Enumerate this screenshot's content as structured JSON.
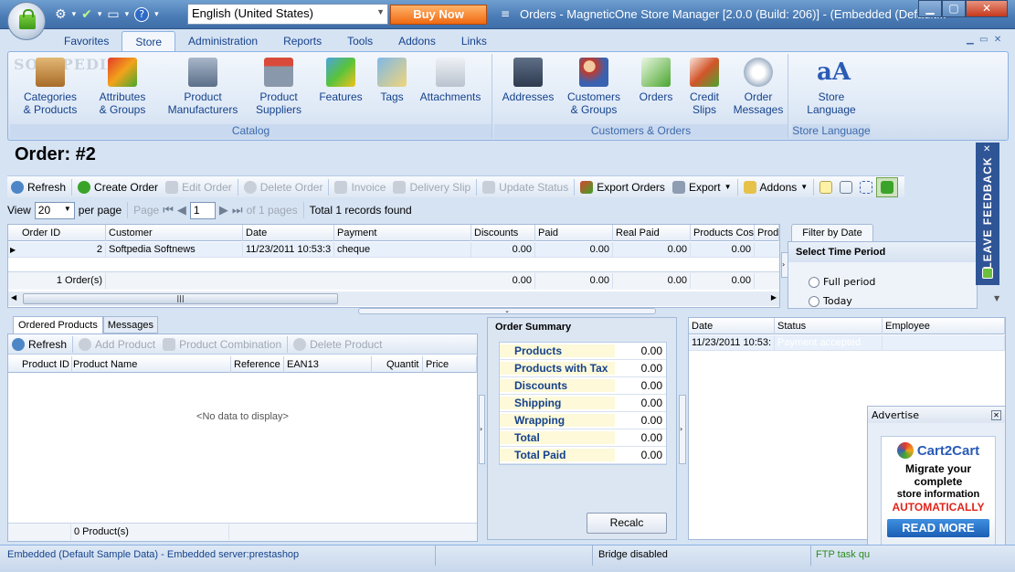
{
  "window": {
    "title": "Orders - MagneticOne Store Manager [2.0.0 (Build: 206)] - (Embedded (Default...",
    "language": "English (United States)",
    "buy_now": "Buy Now"
  },
  "ribbon": {
    "tabs": [
      "Favorites",
      "Store",
      "Administration",
      "Reports",
      "Tools",
      "Addons",
      "Links"
    ],
    "active_tab": "Store",
    "catalog": {
      "label": "Catalog",
      "buttons": [
        {
          "line1": "Categories",
          "line2": "& Products"
        },
        {
          "line1": "Attributes",
          "line2": "& Groups"
        },
        {
          "line1": "Product",
          "line2": "Manufacturers"
        },
        {
          "line1": "Product",
          "line2": "Suppliers"
        },
        {
          "line1": "Features",
          "line2": ""
        },
        {
          "line1": "Tags",
          "line2": ""
        },
        {
          "line1": "Attachments",
          "line2": ""
        }
      ]
    },
    "customers_orders": {
      "label": "Customers & Orders",
      "buttons": [
        {
          "line1": "Addresses",
          "line2": ""
        },
        {
          "line1": "Customers",
          "line2": "& Groups"
        },
        {
          "line1": "Orders",
          "line2": ""
        },
        {
          "line1": "Credit",
          "line2": "Slips"
        },
        {
          "line1": "Order",
          "line2": "Messages"
        }
      ]
    },
    "store_language": {
      "label": "Store Language",
      "buttons": [
        {
          "line1": "Store",
          "line2": "Language"
        }
      ]
    }
  },
  "order": {
    "title": "Order: #2"
  },
  "toolbar": {
    "refresh": "Refresh",
    "create_order": "Create Order",
    "edit_order": "Edit Order",
    "delete_order": "Delete Order",
    "invoice": "Invoice",
    "delivery_slip": "Delivery Slip",
    "update_status": "Update Status",
    "export_orders": "Export Orders",
    "export": "Export",
    "addons": "Addons"
  },
  "pager": {
    "view_label": "View",
    "per_page_value": "20",
    "per_page_label": "per page",
    "page_label": "Page",
    "page_value": "1",
    "of_pages": "of 1 pages",
    "records_found": "Total 1 records found"
  },
  "orders_grid": {
    "columns": [
      "Order ID",
      "Customer",
      "Date",
      "Payment",
      "Discounts",
      "Paid",
      "Real Paid",
      "Products Cost",
      "Produ"
    ],
    "rows": [
      {
        "id": "2",
        "customer": "Softpedia Softnews",
        "date": "11/23/2011 10:53:3",
        "payment": "cheque",
        "discounts": "0.00",
        "paid": "0.00",
        "real_paid": "0.00",
        "products_cost": "0.00"
      }
    ],
    "footer": {
      "count": "1 Order(s)",
      "discounts": "0.00",
      "paid": "0.00",
      "real_paid": "0.00",
      "products_cost": "0.00"
    }
  },
  "filter": {
    "tab": "Filter by Date",
    "header": "Select Time Period",
    "options": [
      "Full period",
      "Today"
    ]
  },
  "feedback": "LEAVE FEEDBACK",
  "products_panel": {
    "tabs": [
      "Ordered Products",
      "Messages"
    ],
    "refresh": "Refresh",
    "add_product": "Add Product",
    "product_combination": "Product Combination",
    "delete_product": "Delete Product",
    "columns": [
      "Product ID",
      "Product Name",
      "Reference",
      "EAN13",
      "Quantit",
      "Price"
    ],
    "empty": "<No data to display>",
    "footer": "0 Product(s)"
  },
  "summary": {
    "title": "Order Summary",
    "rows": [
      {
        "label": "Products",
        "value": "0.00"
      },
      {
        "label": "Products with Tax",
        "value": "0.00"
      },
      {
        "label": "Discounts",
        "value": "0.00"
      },
      {
        "label": "Shipping",
        "value": "0.00"
      },
      {
        "label": "Wrapping",
        "value": "0.00"
      },
      {
        "label": "Total",
        "value": "0.00"
      },
      {
        "label": "Total Paid",
        "value": "0.00"
      }
    ],
    "recalc": "Recalc"
  },
  "history": {
    "columns": [
      "Date",
      "Status",
      "Employee"
    ],
    "rows": [
      {
        "date": "11/23/2011 10:53:",
        "status": "Payment accepted",
        "employee": ""
      }
    ]
  },
  "advert": {
    "title": "Advertise",
    "brand": "Cart2Cart",
    "line1": "Migrate your",
    "line2": "complete",
    "line3": "store information",
    "line4": "AUTOMATICALLY",
    "cta": "READ MORE"
  },
  "statusbar": {
    "connection": "Embedded (Default Sample Data) - Embedded server:prestashop",
    "bridge": "Bridge disabled",
    "ftp": "FTP task qu"
  },
  "watermark": "SOFTPEDIA"
}
